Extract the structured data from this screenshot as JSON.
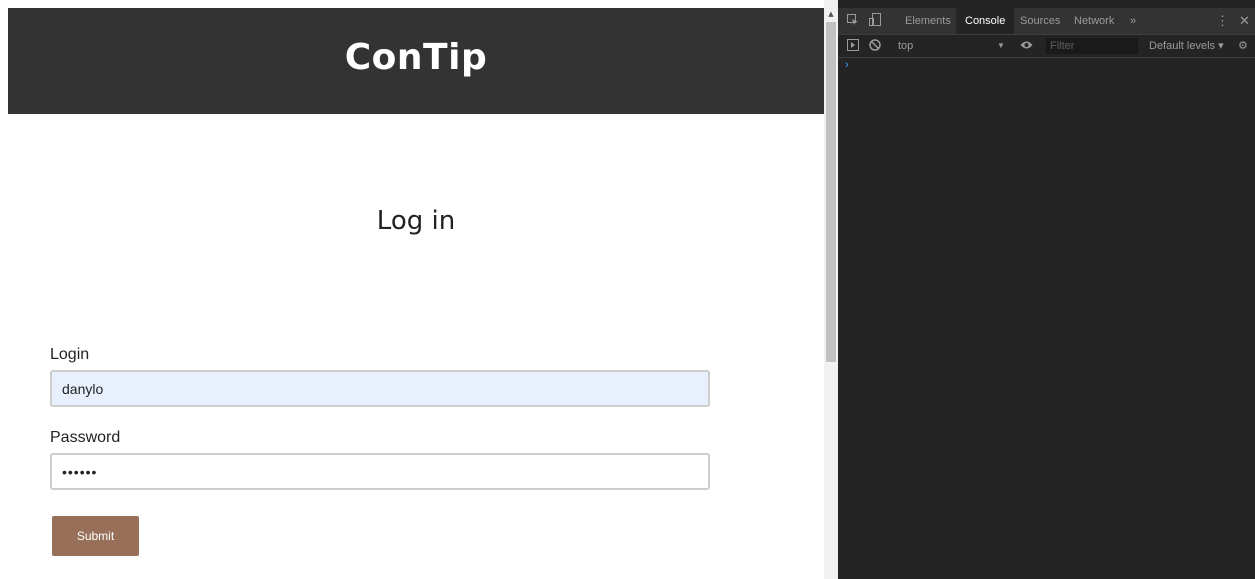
{
  "site": {
    "title": "ConTip"
  },
  "form": {
    "heading": "Log in",
    "login_label": "Login",
    "login_value": "danylo",
    "password_label": "Password",
    "password_value": "••••••",
    "submit_label": "Submit"
  },
  "devtools": {
    "tabs": [
      "Elements",
      "Console",
      "Sources",
      "Network"
    ],
    "active_tab": "Console",
    "more_tabs_glyph": "»",
    "context": "top",
    "filter_placeholder": "Filter",
    "levels": "Default levels ▾",
    "prompt": "›"
  },
  "colors": {
    "header_bg": "#333333",
    "submit_bg": "#98705a",
    "autofill_bg": "#e8f0fe",
    "devtools_bg": "#242424"
  }
}
